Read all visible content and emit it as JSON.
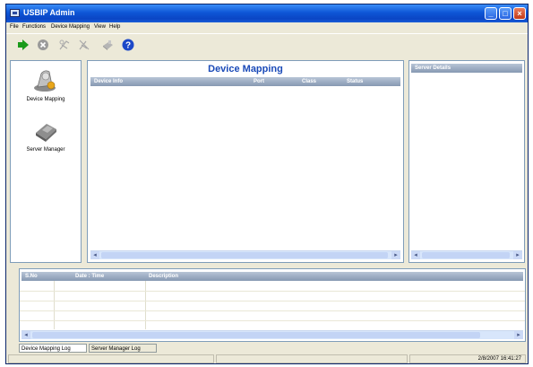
{
  "window": {
    "title": "USBIP Admin"
  },
  "titlebar": {
    "minimize": "_",
    "maximize": "□",
    "close": "×"
  },
  "menu": [
    "File",
    "Functions",
    "Device Mapping",
    "View",
    "Help"
  ],
  "toolbar": [
    "play-icon",
    "stop-icon",
    "map-device-icon",
    "unmap-device-icon",
    "server-icon",
    "help-icon"
  ],
  "nav": {
    "items": [
      {
        "label": "Device Mapping",
        "icon": "device-icon"
      },
      {
        "label": "Server Manager",
        "icon": "server-manager-icon"
      }
    ]
  },
  "device_panel": {
    "title": "Device Mapping",
    "columns": [
      "Device Info",
      "Port",
      "Class",
      "Status"
    ]
  },
  "server_panel": {
    "header": "Server Details"
  },
  "log": {
    "columns": [
      "S.No",
      "Date : Time",
      "Description"
    ]
  },
  "tabs": [
    "Device Mapping Log",
    "Server Manager Log"
  ],
  "status": {
    "timestamp": "2/8/2007 16:41:27"
  },
  "colors": {
    "titlebar": "#0e56d6",
    "panel_title": "#1a4ab8",
    "header": "#8799b2"
  }
}
